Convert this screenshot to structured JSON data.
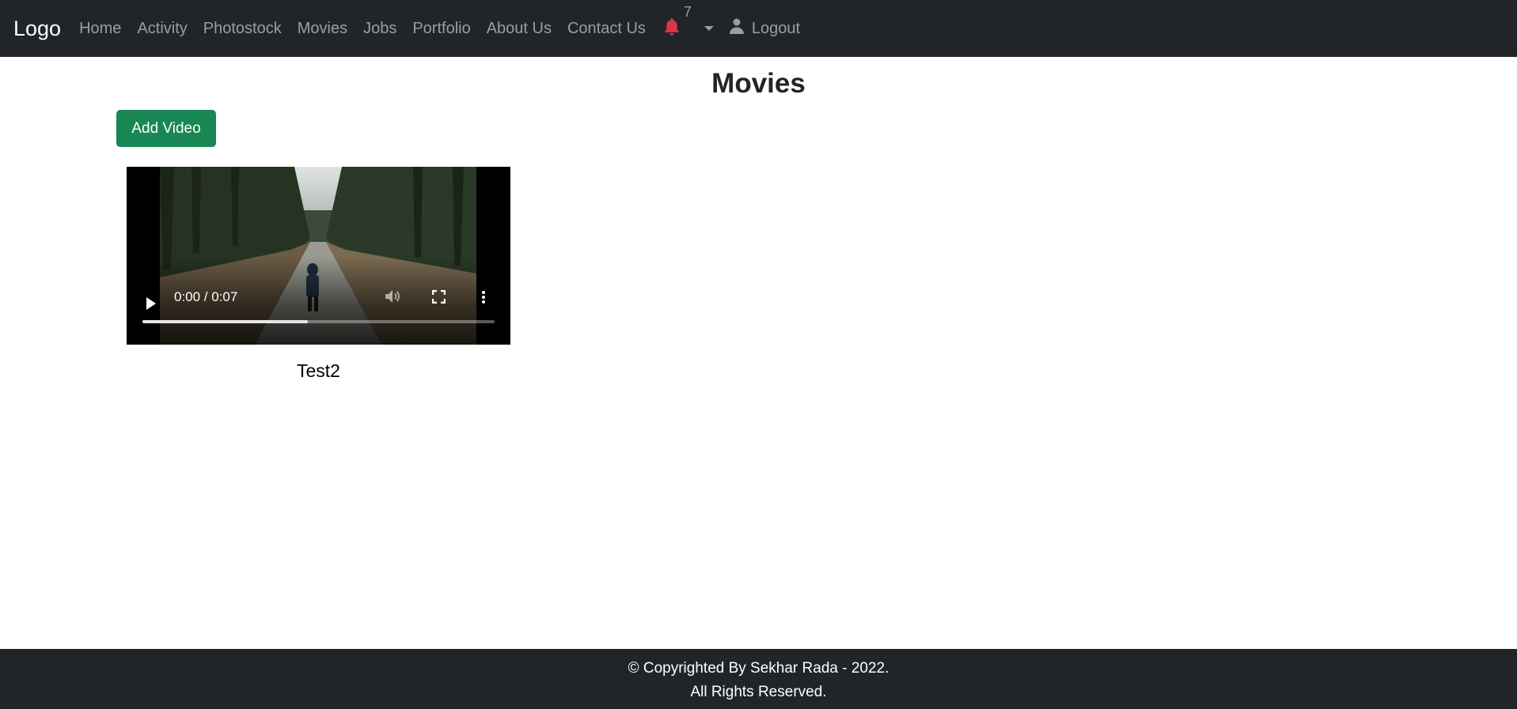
{
  "navbar": {
    "brand": "Logo",
    "links": [
      "Home",
      "Activity",
      "Photostock",
      "Movies",
      "Jobs",
      "Portfolio",
      "About Us",
      "Contact Us"
    ],
    "notifications_count": "7",
    "logout_label": "Logout",
    "bell_color": "#dc3545"
  },
  "main": {
    "title": "Movies",
    "add_button_label": "Add Video",
    "video": {
      "time_display": "0:00 / 0:07",
      "progress": 0.47,
      "title": "Test2"
    }
  },
  "footer": {
    "line1": "© Copyrighted By Sekhar Rada - 2022.",
    "line2": "All Rights Reserved."
  },
  "colors": {
    "navbar_bg": "#212529",
    "button_green": "#198754"
  }
}
